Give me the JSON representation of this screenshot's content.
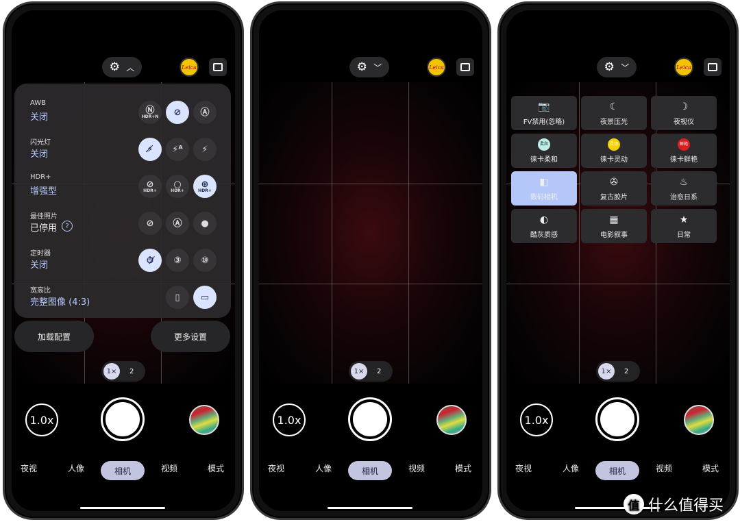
{
  "top_bar": {
    "settings_icon": "gear-icon",
    "expand_up": "chevron-up-icon",
    "expand_down": "chevron-down-icon",
    "leica_logo": "Leica",
    "aspect_icon": "aspect-toggle-icon"
  },
  "zoom_pill": {
    "active": "1×",
    "other": "2"
  },
  "zoom_button": "1.0x",
  "modes": [
    {
      "label": "夜视"
    },
    {
      "label": "人像"
    },
    {
      "label": "相机",
      "selected": true
    },
    {
      "label": "视频"
    },
    {
      "label": "模式"
    }
  ],
  "settings_panel": {
    "rows": [
      {
        "label": "AWB",
        "value": "关闭",
        "options": [
          "HDR+N",
          "AWB off",
          "AW"
        ],
        "selected": 1
      },
      {
        "label": "闪光灯",
        "value": "关闭",
        "options": [
          "flash off",
          "flash auto",
          "flash on"
        ],
        "selected": 0
      },
      {
        "label": "HDR+",
        "value": "增强型",
        "options": [
          "HDR+",
          "HDR+",
          "HDR+"
        ],
        "selected": 2
      },
      {
        "label": "最佳照片",
        "value": "已停用",
        "options": [
          "off",
          "auto",
          "on"
        ],
        "selected": -1
      },
      {
        "label": "定时器",
        "value": "关闭",
        "options": [
          "timer off",
          "3",
          "10"
        ],
        "selected": 0
      },
      {
        "label": "宽高比",
        "value": "完整图像 (4:3)",
        "options": [
          "9:16",
          "4:3"
        ],
        "selected": 1
      }
    ],
    "load_config": "加载配置",
    "more_settings": "更多设置"
  },
  "filters": [
    {
      "label": "FV禁用(忽略)",
      "icon": "camera-icon"
    },
    {
      "label": "夜景压光",
      "icon": "moon-icon"
    },
    {
      "label": "夜视仪",
      "icon": "moon-star-icon"
    },
    {
      "label": "徕卡柔和",
      "icon": "leica-soft-icon",
      "badge": "柔和",
      "color": "#bfeee8"
    },
    {
      "label": "徕卡灵动",
      "icon": "leica-vivid-icon",
      "badge": "灵动",
      "color": "#f5d300"
    },
    {
      "label": "徕卡鲜艳",
      "icon": "leica-bright-icon",
      "badge": "鲜艳",
      "color": "#d81e1e"
    },
    {
      "label": "数码相机",
      "icon": "digital-camera-icon",
      "selected": true
    },
    {
      "label": "复古胶片",
      "icon": "film-reel-icon"
    },
    {
      "label": "治愈日系",
      "icon": "flame-icon"
    },
    {
      "label": "酷灰质感",
      "icon": "half-circle-icon"
    },
    {
      "label": "电影叙事",
      "icon": "film-strip-icon"
    },
    {
      "label": "日常",
      "icon": "star-icon"
    }
  ],
  "watermark": {
    "logo": "值",
    "text": "什么值得买"
  },
  "colors": {
    "accent": "#b5c8ff",
    "selected_mode": "#c3c5e0",
    "selected_filter": "#b4c7f8"
  }
}
